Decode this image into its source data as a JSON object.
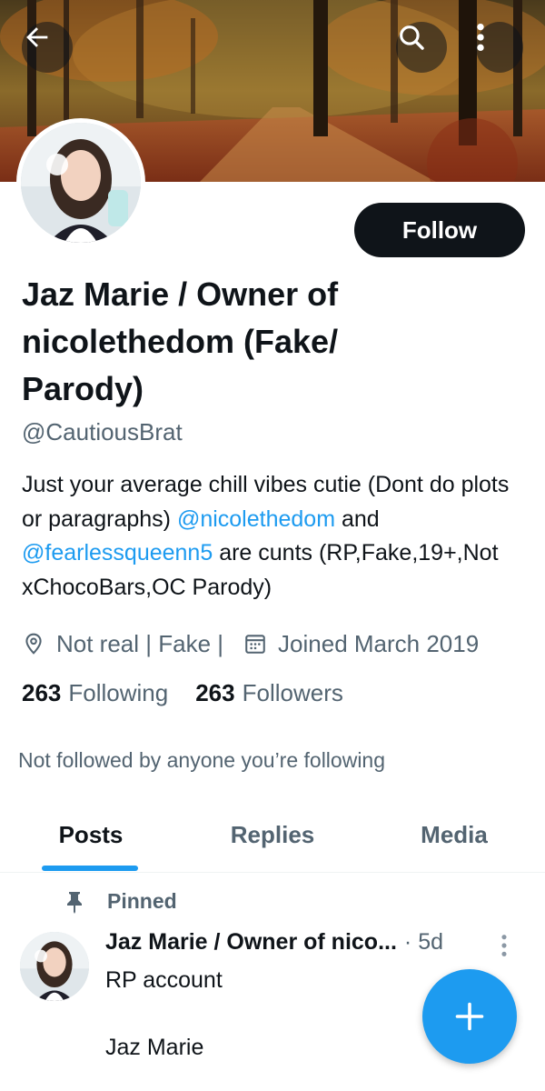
{
  "header": {
    "back_icon": "arrow-left-icon",
    "search_icon": "search-icon",
    "more_icon": "more-vertical-icon"
  },
  "profile": {
    "display_name": "Jaz Marie / Owner of nicolethedom (Fake/ Parody)",
    "handle": "@CautiousBrat",
    "follow_label": "Follow",
    "bio_part1": "Just your average chill vibes cutie (Dont do plots or paragraphs) ",
    "bio_mention1": "@nicolethedom",
    "bio_part2": " and ",
    "bio_mention2": "@fearlessqueenn5",
    "bio_part3": " are cunts (RP,Fake,19+,Not xChocoBars,OC Parody)",
    "location": "Not real | Fake |",
    "joined": "Joined March 2019",
    "following_count": "263",
    "following_label": "Following",
    "followers_count": "263",
    "followers_label": "Followers",
    "not_followed_text": "Not followed by anyone you’re following"
  },
  "tabs": [
    {
      "label": "Posts",
      "active": true
    },
    {
      "label": "Replies",
      "active": false
    },
    {
      "label": "Media",
      "active": false
    }
  ],
  "pinned_post": {
    "pinned_label": "Pinned",
    "author": "Jaz Marie / Owner of nico...",
    "time": "· 5d",
    "text_line1": "RP account",
    "text_line2": "Jaz Marie"
  },
  "colors": {
    "accent": "#1d9bf0",
    "text_primary": "#0f1419",
    "text_secondary": "#536471"
  }
}
